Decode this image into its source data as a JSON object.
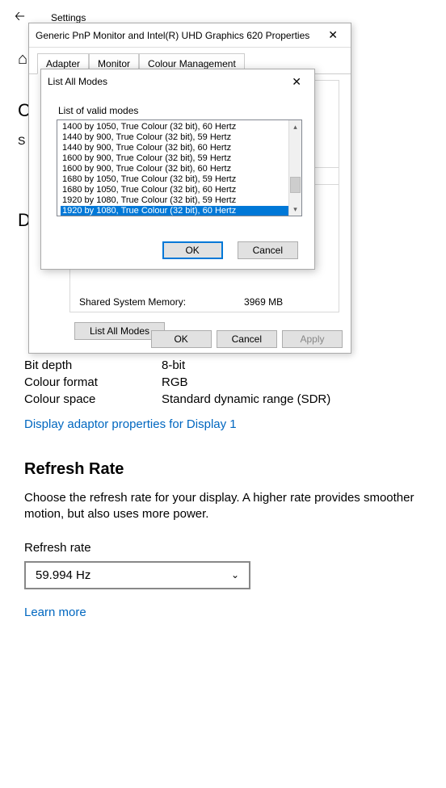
{
  "settings": {
    "title": "Settings"
  },
  "display": {
    "bit_depth_label": "Bit depth",
    "bit_depth_value": "8-bit",
    "colour_format_label": "Colour format",
    "colour_format_value": "RGB",
    "colour_space_label": "Colour space",
    "colour_space_value": "Standard dynamic range (SDR)",
    "adaptor_link": "Display adaptor properties for Display 1"
  },
  "refresh": {
    "heading": "Refresh Rate",
    "description": "Choose the refresh rate for your display. A higher rate provides smoother motion, but also uses more power.",
    "field_label": "Refresh rate",
    "selected": "59.994 Hz",
    "learn_more": "Learn more"
  },
  "props": {
    "title": "Generic PnP Monitor and Intel(R) UHD Graphics 620 Properties",
    "tabs": [
      "Adapter",
      "Monitor",
      "Colour Management"
    ],
    "shared_mem_label": "Shared System Memory:",
    "shared_mem_value": "3969 MB",
    "list_all_modes_btn": "List All Modes",
    "ok": "OK",
    "cancel": "Cancel",
    "apply": "Apply"
  },
  "modes": {
    "title": "List All Modes",
    "group_label": "List of valid modes",
    "items": [
      "1400 by 1050, True Colour (32 bit), 60 Hertz",
      "1440 by 900, True Colour (32 bit), 59 Hertz",
      "1440 by 900, True Colour (32 bit), 60 Hertz",
      "1600 by 900, True Colour (32 bit), 59 Hertz",
      "1600 by 900, True Colour (32 bit), 60 Hertz",
      "1680 by 1050, True Colour (32 bit), 59 Hertz",
      "1680 by 1050, True Colour (32 bit), 60 Hertz",
      "1920 by 1080, True Colour (32 bit), 59 Hertz",
      "1920 by 1080, True Colour (32 bit), 60 Hertz"
    ],
    "selected_index": 8,
    "ok": "OK",
    "cancel": "Cancel"
  }
}
